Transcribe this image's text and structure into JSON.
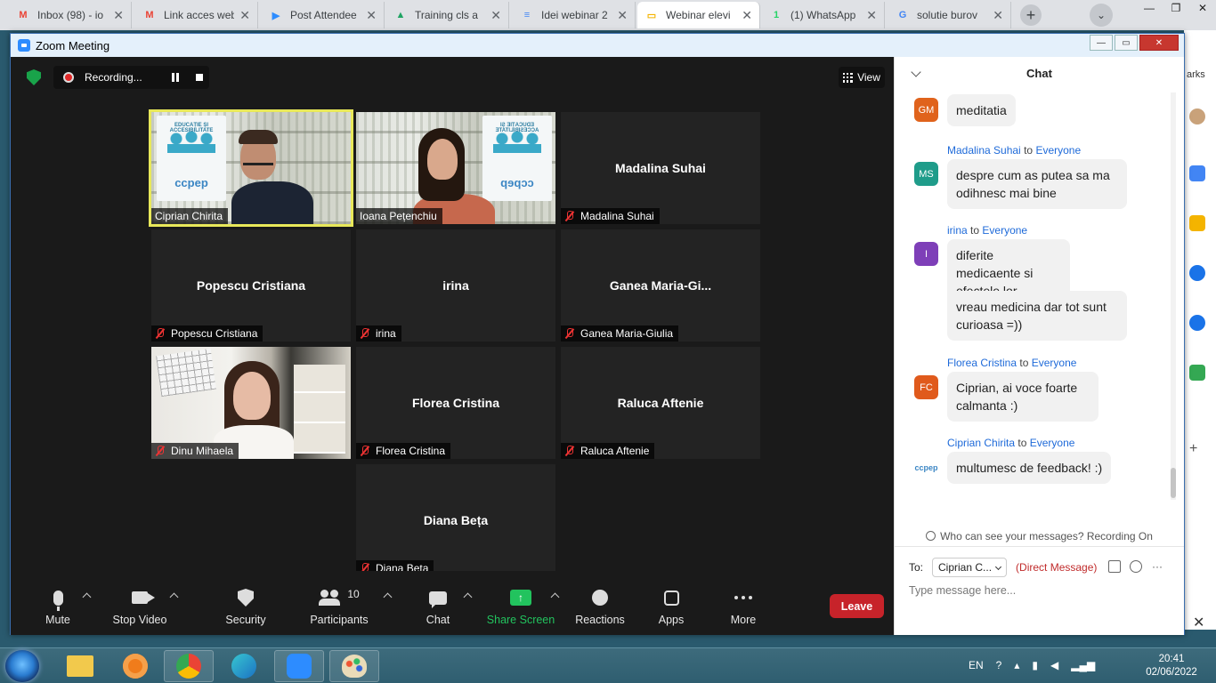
{
  "browser": {
    "tabs": [
      {
        "title": "Inbox (98) - io",
        "icon": "gmail-icon",
        "color": "#ea4335",
        "glyph": "M"
      },
      {
        "title": "Link acces web",
        "icon": "gmail-icon",
        "color": "#ea4335",
        "glyph": "M"
      },
      {
        "title": "Post Attendee",
        "icon": "zoom-icon",
        "color": "#2d8cff",
        "glyph": "▶"
      },
      {
        "title": "Training cls a",
        "icon": "drive-icon",
        "color": "#1fa463",
        "glyph": "▲"
      },
      {
        "title": "Idei webinar 2",
        "icon": "docs-icon",
        "color": "#4285f4",
        "glyph": "≡"
      },
      {
        "title": "Webinar elevi",
        "icon": "slides-icon",
        "color": "#f4b400",
        "glyph": "▭"
      },
      {
        "title": "(1) WhatsApp",
        "icon": "whatsapp-icon",
        "color": "#25d366",
        "glyph": "1"
      },
      {
        "title": "solutie burov",
        "icon": "google-icon",
        "color": "#4285f4",
        "glyph": "G"
      }
    ],
    "active_tab_index": 5
  },
  "behind_text": "arks",
  "zoom": {
    "window_title": "Zoom Meeting",
    "recording_label": "Recording...",
    "view_label": "View",
    "tiles": [
      {
        "name": "Ciprian Chirita",
        "video": true,
        "muted": false,
        "active": true
      },
      {
        "name": "Ioana Pețenchiu",
        "video": true,
        "muted": false
      },
      {
        "name": "Madalina Suhai",
        "big": "Madalina Suhai",
        "muted": true
      },
      {
        "name": "Popescu Cristiana",
        "big": "Popescu Cristiana",
        "muted": true
      },
      {
        "name": "irina",
        "big": "irina",
        "muted": true
      },
      {
        "name": "Ganea Maria-Giulia",
        "big": "Ganea  Maria-Gi...",
        "muted": true
      },
      {
        "name": "Dinu Mihaela",
        "video": true,
        "muted": true
      },
      {
        "name": "Florea Cristina",
        "big": "Florea Cristina",
        "muted": true
      },
      {
        "name": "Raluca Aftenie",
        "big": "Raluca Aftenie",
        "muted": true
      },
      {
        "name": "Diana Bețа",
        "big": "Diana Bețа",
        "muted": true
      }
    ],
    "poster": {
      "title": "EDUCAȚIE ȘI ACCESIBILITATE",
      "logo": "ccpep"
    },
    "toolbar": {
      "mute": "Mute",
      "stop_video": "Stop Video",
      "security": "Security",
      "participants": "Participants",
      "participants_count": "10",
      "chat": "Chat",
      "share_screen": "Share Screen",
      "reactions": "Reactions",
      "apps": "Apps",
      "more": "More",
      "leave": "Leave"
    }
  },
  "chat": {
    "title": "Chat",
    "messages": [
      {
        "avatar": "GM",
        "avatar_color": "#e0631c",
        "sender": "",
        "to": "",
        "lines": [
          "meditatia"
        ]
      },
      {
        "avatar": "MS",
        "avatar_color": "#1f9c8a",
        "sender": "Madalina Suhai",
        "to": "Everyone",
        "lines": [
          "despre cum as putea sa ma odihnesc mai bine"
        ]
      },
      {
        "avatar": "I",
        "avatar_color": "#7e3fb8",
        "sender": "irina",
        "to": "Everyone",
        "lines": [
          "diferite medicaente si efectele lor",
          "vreau medicina dar tot sunt curioasa =))"
        ]
      },
      {
        "avatar": "FC",
        "avatar_color": "#e05a1c",
        "sender": "Florea Cristina",
        "to": "Everyone",
        "lines": [
          "Ciprian, ai  voce foarte calmanta :)"
        ]
      },
      {
        "avatar": "ccpep",
        "avatar_color": "#ffffff",
        "sender": "Ciprian Chirita",
        "to": "Everyone",
        "lines": [
          "multumesc de feedback! :)"
        ]
      }
    ],
    "to_word": "to",
    "who_can_see": "Who can see your messages? Recording On",
    "to_label": "To:",
    "to_value": "Ciprian C...",
    "direct_message": "(Direct Message)",
    "input_placeholder": "Type message here..."
  },
  "taskbar": {
    "lang": "EN",
    "time": "20:41",
    "date": "02/06/2022"
  }
}
